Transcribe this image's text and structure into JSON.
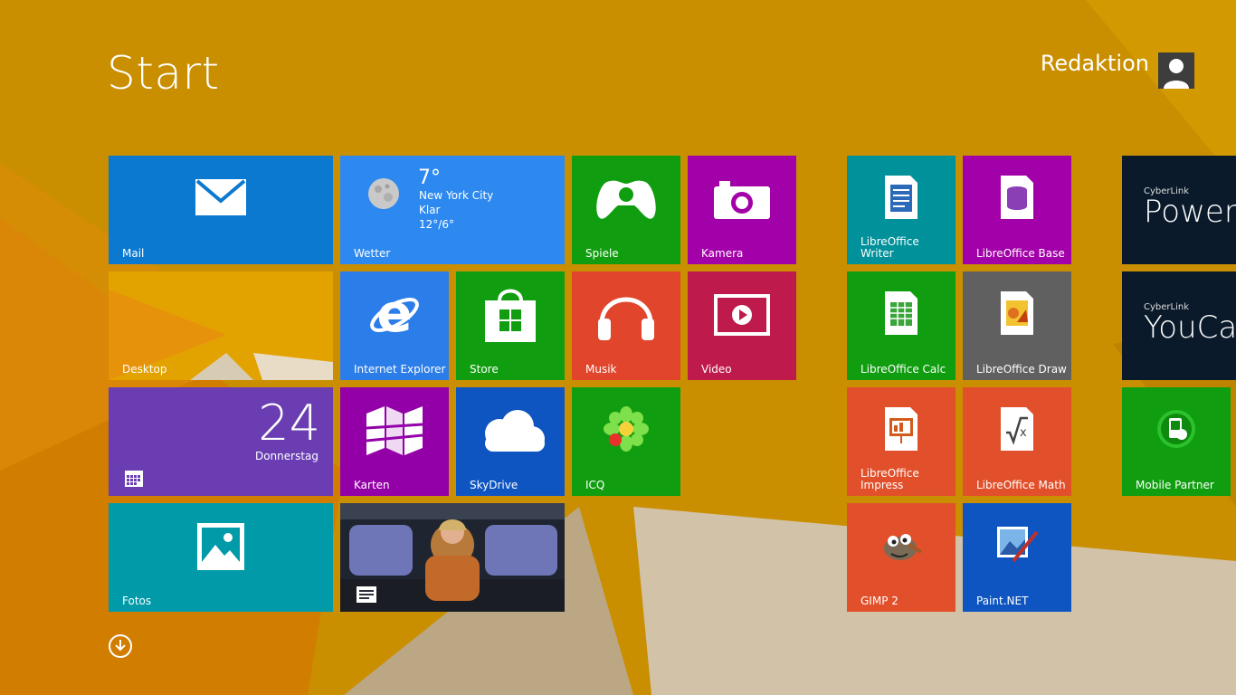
{
  "screen": {
    "title": "Start",
    "background_color": "#c98f00"
  },
  "user": {
    "name": "Redaktion",
    "avatar_icon": "user-silhouette-icon"
  },
  "tiles": {
    "mail": {
      "label": "Mail",
      "color": "#0b79d0",
      "icon": "envelope-icon"
    },
    "weather": {
      "label": "Wetter",
      "color": "#2d89ef",
      "icon": "moon-icon",
      "temperature": "7°",
      "city": "New York City",
      "condition": "Klar",
      "range": "12°/6°"
    },
    "games": {
      "label": "Spiele",
      "color": "#109e10",
      "icon": "controller-icon"
    },
    "camera": {
      "label": "Kamera",
      "color": "#a200a8",
      "icon": "camera-icon"
    },
    "desktop": {
      "label": "Desktop",
      "color": "#e0a500"
    },
    "ie": {
      "label": "Internet Explorer",
      "color": "#2b7de9",
      "icon": "internet-explorer-icon"
    },
    "store": {
      "label": "Store",
      "color": "#109e10",
      "icon": "store-bag-icon"
    },
    "music": {
      "label": "Musik",
      "color": "#e1452b",
      "icon": "headphones-icon"
    },
    "video": {
      "label": "Video",
      "color": "#be1a4b",
      "icon": "video-play-icon"
    },
    "calendar": {
      "label": "",
      "color": "#6a3db3",
      "day": "24",
      "weekday": "Donnerstag",
      "icon": "calendar-icon"
    },
    "maps": {
      "label": "Karten",
      "color": "#9300a8",
      "icon": "map-icon"
    },
    "skydrive": {
      "label": "SkyDrive",
      "color": "#0f55c1",
      "icon": "cloud-icon"
    },
    "icq": {
      "label": "ICQ",
      "color": "#109e10",
      "icon": "icq-flower-icon"
    },
    "photos": {
      "label": "Fotos",
      "color": "#009aa8",
      "icon": "picture-icon"
    },
    "news": {
      "label": "",
      "icon": "news-icon"
    },
    "lo_writer": {
      "label": "LibreOffice\nWriter",
      "color": "#00919a",
      "icon": "libreoffice-writer-icon"
    },
    "lo_base": {
      "label": "LibreOffice Base",
      "color": "#a200a8",
      "icon": "libreoffice-base-icon"
    },
    "lo_calc": {
      "label": "LibreOffice Calc",
      "color": "#109e10",
      "icon": "libreoffice-calc-icon"
    },
    "lo_draw": {
      "label": "LibreOffice Draw",
      "color": "#606060",
      "icon": "libreoffice-draw-icon"
    },
    "lo_impress": {
      "label": "LibreOffice\nImpress",
      "color": "#e1502b",
      "icon": "libreoffice-impress-icon"
    },
    "lo_math": {
      "label": "LibreOffice Math",
      "color": "#e1502b",
      "icon": "libreoffice-math-icon"
    },
    "gimp": {
      "label": "GIMP 2",
      "color": "#e1502b",
      "icon": "gimp-icon"
    },
    "paintnet": {
      "label": "Paint.NET",
      "color": "#0f55c1",
      "icon": "paintnet-icon"
    },
    "powerdvd": {
      "brand": "CyberLink",
      "product": "PowerD",
      "color": "#0a1a2a"
    },
    "youcam": {
      "brand": "CyberLink",
      "product": "YouCa",
      "color": "#0a1a2a"
    },
    "mobile_partner": {
      "label": "Mobile Partner",
      "color": "#109e10",
      "icon": "mobile-partner-icon"
    }
  },
  "nav": {
    "all_apps_icon": "arrow-down-circle-icon"
  }
}
